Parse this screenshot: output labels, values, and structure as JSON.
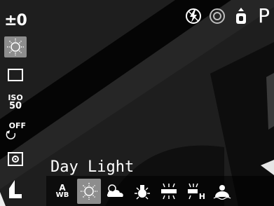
{
  "camera": {
    "exposure_compensation": "±0",
    "shooting_mode": "P",
    "white_balance_label": "Day Light",
    "iso": {
      "top": "ISO",
      "value": "50"
    },
    "face_detect": "OFF",
    "left_modes": [
      {
        "name": "exposure-compensation",
        "icon": "plus-minus-icon"
      },
      {
        "name": "white-balance-daylight",
        "icon": "sun-icon",
        "selected": true
      },
      {
        "name": "my-colors",
        "icon": "square-frame-icon"
      },
      {
        "name": "iso",
        "icon": "iso-icon"
      },
      {
        "name": "self-timer-off",
        "icon": "timer-off-icon"
      },
      {
        "name": "metering",
        "icon": "metering-icon"
      },
      {
        "name": "image-size",
        "icon": "large-size-icon"
      }
    ],
    "top_icons": [
      "flash-off-icon",
      "red-eye-icon",
      "mic-icon"
    ],
    "wb_options": [
      {
        "name": "auto",
        "label": "AWB",
        "icon": "awb-icon"
      },
      {
        "name": "daylight",
        "icon": "sun-icon",
        "selected": true
      },
      {
        "name": "cloudy",
        "icon": "cloud-icon"
      },
      {
        "name": "tungsten",
        "icon": "tungsten-icon"
      },
      {
        "name": "fluorescent",
        "icon": "fluorescent-icon"
      },
      {
        "name": "fluorescent-h",
        "icon": "fluorescent-h-icon",
        "label": "H"
      },
      {
        "name": "underwater",
        "icon": "underwater-icon"
      }
    ],
    "colors": {
      "selected_bg": "#8d8d8d",
      "icon": "#ffffff"
    }
  }
}
